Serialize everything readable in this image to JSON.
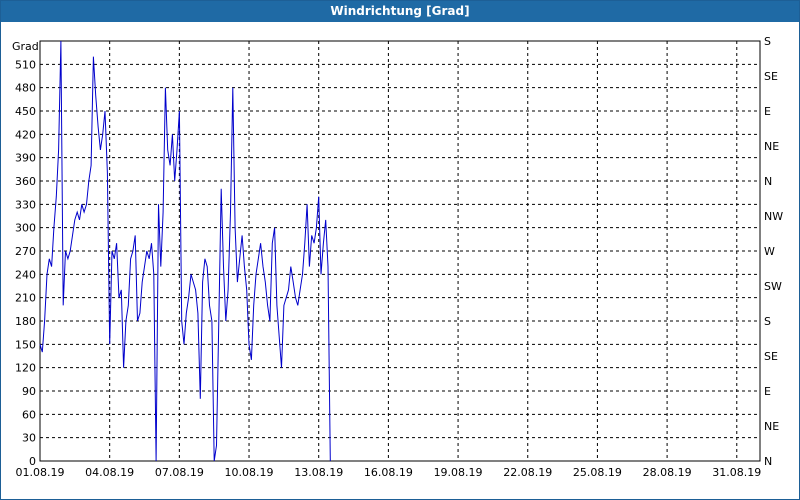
{
  "window": {
    "title": "Windrichtung [Grad]"
  },
  "chart_data": {
    "type": "line",
    "title": "Windrichtung [Grad]",
    "ylabel": "Grad",
    "xlabel": "",
    "ylim": [
      0,
      540
    ],
    "grid": true,
    "y_ticks": [
      0,
      30,
      60,
      90,
      120,
      150,
      180,
      210,
      240,
      270,
      300,
      330,
      360,
      390,
      420,
      450,
      480,
      510
    ],
    "right_axis": {
      "labels": [
        "N",
        "NE",
        "E",
        "SE",
        "S",
        "SW",
        "W",
        "NW",
        "N",
        "NE",
        "E",
        "SE",
        "S"
      ],
      "values": [
        0,
        45,
        90,
        135,
        180,
        225,
        270,
        315,
        360,
        405,
        450,
        495,
        540
      ]
    },
    "x_ticks": {
      "labels": [
        "01.08.19",
        "04.08.19",
        "07.08.19",
        "10.08.19",
        "13.08.19",
        "16.08.19",
        "19.08.19",
        "22.08.19",
        "25.08.19",
        "28.08.19",
        "31.08.19"
      ],
      "day_values": [
        1,
        4,
        7,
        10,
        13,
        16,
        19,
        22,
        25,
        28,
        31
      ]
    },
    "xlim_days": [
      1,
      32
    ],
    "line_color": "#0000cc",
    "series": [
      {
        "name": "",
        "x_days": [
          1.0,
          1.1,
          1.2,
          1.3,
          1.4,
          1.5,
          1.6,
          1.7,
          1.8,
          1.9,
          2.0,
          2.1,
          2.2,
          2.3,
          2.4,
          2.5,
          2.6,
          2.7,
          2.8,
          2.9,
          3.0,
          3.1,
          3.2,
          3.3,
          3.4,
          3.5,
          3.6,
          3.7,
          3.8,
          3.9,
          4.0,
          4.1,
          4.2,
          4.3,
          4.4,
          4.5,
          4.6,
          4.7,
          4.8,
          4.9,
          5.0,
          5.1,
          5.2,
          5.3,
          5.4,
          5.5,
          5.6,
          5.7,
          5.8,
          5.9,
          6.0,
          6.1,
          6.2,
          6.3,
          6.4,
          6.5,
          6.6,
          6.7,
          6.8,
          6.9,
          7.0,
          7.1,
          7.2,
          7.3,
          7.4,
          7.5,
          7.6,
          7.7,
          7.8,
          7.9,
          8.0,
          8.1,
          8.2,
          8.3,
          8.4,
          8.5,
          8.6,
          8.7,
          8.8,
          8.9,
          9.0,
          9.1,
          9.2,
          9.3,
          9.4,
          9.5,
          9.6,
          9.7,
          9.8,
          9.9,
          10.0,
          10.1,
          10.2,
          10.3,
          10.4,
          10.5,
          10.6,
          10.7,
          10.8,
          10.9,
          11.0,
          11.1,
          11.2,
          11.3,
          11.4,
          11.5,
          11.6,
          11.7,
          11.8,
          11.9,
          12.0,
          12.1,
          12.2,
          12.3,
          12.4,
          12.5,
          12.6,
          12.7,
          12.8,
          12.9,
          13.0,
          13.1,
          13.2,
          13.3,
          13.4,
          13.5,
          13.6,
          13.7,
          13.8,
          13.9,
          14.0,
          14.1,
          14.2,
          14.3,
          14.4,
          14.5,
          14.6,
          14.7,
          14.8,
          14.9,
          15.0,
          15.1,
          15.2,
          15.3,
          15.4,
          15.5,
          15.6,
          15.7,
          15.8,
          15.9,
          16.0,
          16.1,
          16.2,
          16.3,
          16.4,
          16.5,
          16.6,
          16.7,
          16.8,
          16.9,
          17.0,
          17.1,
          17.2,
          17.3,
          17.4,
          17.5,
          17.6,
          17.7,
          17.8,
          17.9,
          18.0,
          18.1,
          18.2,
          18.3,
          18.4,
          18.5,
          18.6,
          18.7,
          18.8,
          18.9,
          19.0,
          19.1,
          19.2,
          19.3,
          19.4,
          19.5,
          19.6,
          19.7,
          19.8,
          19.9,
          20.0,
          20.1,
          20.2,
          20.3,
          20.4,
          20.5,
          20.6,
          20.7,
          20.8,
          20.9,
          21.0,
          21.1,
          21.2,
          21.3,
          21.4,
          21.5,
          21.6,
          21.7,
          21.8,
          21.9,
          22.0,
          22.1,
          22.2,
          22.3,
          22.4,
          22.5,
          22.6,
          22.7,
          22.8,
          22.9,
          23.0,
          23.1,
          23.2,
          23.3,
          23.4,
          23.5,
          23.6,
          23.7,
          23.8,
          23.9,
          24.0,
          24.1,
          24.2,
          24.3,
          24.4,
          24.5,
          24.6,
          24.7,
          24.8,
          24.9,
          25.0,
          25.1,
          25.2,
          25.3,
          25.4,
          25.5,
          25.6,
          25.7,
          25.8,
          25.9,
          26.0,
          26.1,
          26.2,
          26.3,
          26.4,
          26.5,
          26.6,
          26.7,
          26.8,
          26.9,
          27.0,
          27.1,
          27.2,
          27.3,
          27.4,
          27.5,
          27.6,
          27.7,
          27.8,
          27.9,
          28.0,
          28.1,
          28.2,
          28.3,
          28.4,
          28.5,
          28.6,
          28.7,
          28.8,
          28.9,
          29.0,
          29.1,
          29.2,
          29.3,
          29.4,
          29.5,
          29.6,
          29.7,
          29.8,
          29.9,
          30.0,
          30.1,
          30.2,
          30.3,
          30.4,
          30.5,
          30.6,
          30.7,
          30.8,
          30.9,
          31.0,
          31.1,
          31.2,
          31.3,
          31.4,
          31.5,
          31.6,
          31.7,
          31.8,
          31.9,
          32.0
        ],
        "values": [
          150,
          140,
          180,
          240,
          260,
          250,
          300,
          340,
          400,
          540,
          200,
          270,
          260,
          270,
          290,
          310,
          320,
          310,
          330,
          320,
          330,
          360,
          380,
          520,
          470,
          430,
          400,
          420,
          450,
          370,
          150,
          270,
          260,
          280,
          210,
          220,
          120,
          180,
          200,
          260,
          270,
          290,
          180,
          190,
          230,
          250,
          270,
          260,
          280,
          240,
          0,
          330,
          250,
          320,
          480,
          400,
          380,
          420,
          360,
          400,
          450,
          180,
          150,
          190,
          210,
          240,
          230,
          220,
          190,
          80,
          230,
          260,
          250,
          200,
          180,
          0,
          20,
          180,
          350,
          250,
          180,
          220,
          320,
          480,
          300,
          230,
          260,
          290,
          250,
          220,
          150,
          130,
          200,
          240,
          260,
          280,
          250,
          230,
          200,
          180,
          280,
          300,
          200,
          160,
          120,
          200,
          210,
          220,
          250,
          230,
          210,
          200,
          220,
          240,
          280,
          330,
          250,
          290,
          280,
          300,
          340,
          240,
          280,
          310,
          250,
          0,
          0,
          0,
          0,
          0,
          0,
          0,
          0,
          0,
          0,
          0,
          0,
          0,
          0,
          0,
          0,
          0,
          0,
          0,
          0,
          0,
          0,
          0,
          0,
          0,
          0,
          0,
          0,
          0,
          0,
          0,
          0,
          0,
          0,
          0,
          0,
          0,
          0,
          0,
          0,
          0,
          0,
          0,
          0,
          0,
          0,
          0,
          0,
          0,
          0,
          0,
          0,
          0,
          0,
          0,
          0,
          0,
          0,
          0,
          0,
          0,
          0,
          0,
          0,
          0,
          0,
          0,
          0,
          0,
          0,
          0,
          0,
          0,
          0,
          0,
          0,
          0,
          0,
          0,
          0,
          0,
          0,
          0,
          0,
          0,
          0,
          0,
          0,
          0,
          0,
          0,
          0,
          0,
          0,
          0,
          0,
          0,
          0,
          0,
          0,
          0,
          0,
          0,
          0,
          0,
          0,
          0,
          0,
          0,
          0,
          0,
          0,
          0,
          0,
          0,
          0,
          0,
          0,
          0,
          0,
          0,
          0,
          0,
          0,
          0,
          0,
          0,
          0,
          0,
          0,
          0,
          0,
          0,
          0,
          0,
          0,
          0,
          0,
          0,
          0,
          0,
          0,
          0,
          0,
          0,
          0,
          0,
          0,
          0,
          0,
          0,
          0,
          0,
          0,
          0,
          0,
          0,
          0,
          0,
          0,
          0,
          0,
          0,
          0,
          0,
          0,
          0,
          0,
          0,
          0,
          0,
          0,
          0,
          0,
          0,
          0,
          0,
          0,
          0,
          0,
          0,
          0,
          0,
          0,
          0,
          0,
          0,
          0,
          0,
          0,
          0,
          0,
          0,
          0,
          0,
          0,
          0,
          0,
          0
        ]
      }
    ]
  }
}
